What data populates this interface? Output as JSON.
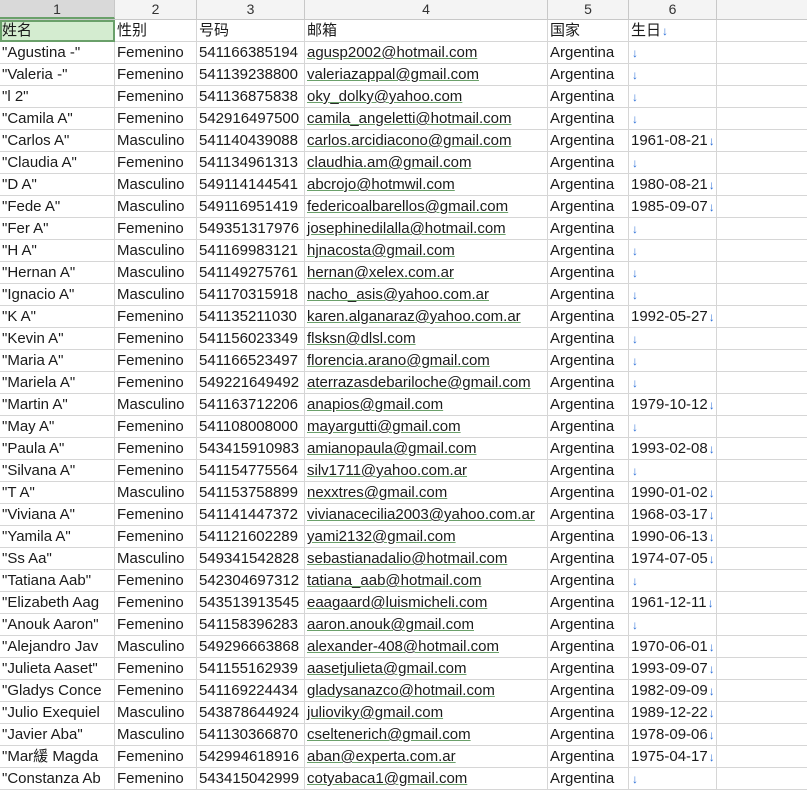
{
  "columns": [
    "1",
    "2",
    "3",
    "4",
    "5",
    "6"
  ],
  "headers": [
    "姓名",
    "性别",
    "号码",
    "邮箱",
    "国家",
    "生日"
  ],
  "arrow_glyph": "↓",
  "rows": [
    [
      "\"Agustina -\"",
      "Femenino",
      "541166385194",
      "agusp2002@hotmail.com",
      "Argentina",
      ""
    ],
    [
      "\"Valeria -\"",
      "Femenino",
      "541139238800",
      "valeriazappal@gmail.com",
      "Argentina",
      ""
    ],
    [
      "\"l 2\"",
      "Femenino",
      "541136875838",
      "oky_dolky@yahoo.com",
      "Argentina",
      ""
    ],
    [
      "\"Camila A\"",
      "Femenino",
      "542916497500",
      "camila_angeletti@hotmail.com",
      "Argentina",
      ""
    ],
    [
      "\"Carlos A\"",
      "Masculino",
      "541140439088",
      "carlos.arcidiacono@gmail.com",
      "Argentina",
      "1961-08-21"
    ],
    [
      "\"Claudia A\"",
      "Femenino",
      "541134961313",
      "claudhia.am@gmail.com",
      "Argentina",
      ""
    ],
    [
      "\"D A\"",
      "Masculino",
      "549114144541",
      "abcrojo@hotmwil.com",
      "Argentina",
      "1980-08-21"
    ],
    [
      "\"Fede A\"",
      "Masculino",
      "549116951419",
      "federicoalbarellos@gmail.com",
      "Argentina",
      "1985-09-07"
    ],
    [
      "\"Fer A\"",
      "Femenino",
      "549351317976",
      "josephinedilalla@hotmail.com",
      "Argentina",
      ""
    ],
    [
      "\"H A\"",
      "Masculino",
      "541169983121",
      "hjnacosta@gmail.com",
      "Argentina",
      ""
    ],
    [
      "\"Hernan A\"",
      "Masculino",
      "541149275761",
      "hernan@xelex.com.ar",
      "Argentina",
      ""
    ],
    [
      "\"Ignacio A\"",
      "Masculino",
      "541170315918",
      "nacho_asis@yahoo.com.ar",
      "Argentina",
      ""
    ],
    [
      "\"K A\"",
      "Femenino",
      "541135211030",
      "karen.alganaraz@yahoo.com.ar",
      "Argentina",
      "1992-05-27"
    ],
    [
      "\"Kevin A\"",
      "Femenino",
      "541156023349",
      "flsksn@dlsl.com",
      "Argentina",
      ""
    ],
    [
      "\"Maria A\"",
      "Femenino",
      "541166523497",
      "florencia.arano@gmail.com",
      "Argentina",
      ""
    ],
    [
      "\"Mariela A\"",
      "Femenino",
      "549221649492",
      "aterrazasdebariloche@gmail.com",
      "Argentina",
      ""
    ],
    [
      "\"Martin A\"",
      "Masculino",
      "541163712206",
      "anapios@gmail.com",
      "Argentina",
      "1979-10-12"
    ],
    [
      "\"May A\"",
      "Femenino",
      "541108008000",
      "mayargutti@gmail.com",
      "Argentina",
      ""
    ],
    [
      "\"Paula A\"",
      "Femenino",
      "543415910983",
      "amianopaula@gmail.com",
      "Argentina",
      "1993-02-08"
    ],
    [
      "\"Silvana A\"",
      "Femenino",
      "541154775564",
      "silv1711@yahoo.com.ar",
      "Argentina",
      ""
    ],
    [
      "\"T A\"",
      "Masculino",
      "541153758899",
      "nexxtres@gmail.com",
      "Argentina",
      "1990-01-02"
    ],
    [
      "\"Viviana A\"",
      "Femenino",
      "541141447372",
      "vivianacecilia2003@yahoo.com.ar",
      "Argentina",
      "1968-03-17"
    ],
    [
      "\"Yamila A\"",
      "Femenino",
      "541121602289",
      "yami2132@gmail.com",
      "Argentina",
      "1990-06-13"
    ],
    [
      "\"Ss Aa\"",
      "Masculino",
      "549341542828",
      "sebastianadalio@hotmail.com",
      "Argentina",
      "1974-07-05"
    ],
    [
      "\"Tatiana Aab\"",
      "Femenino",
      "542304697312",
      "tatiana_aab@hotmail.com",
      "Argentina",
      ""
    ],
    [
      "\"Elizabeth Aag",
      "Femenino",
      "543513913545",
      "eaagaard@luismicheli.com",
      "Argentina",
      "1961-12-11"
    ],
    [
      "\"Anouk Aaron\"",
      "Femenino",
      "541158396283",
      "aaron.anouk@gmail.com",
      "Argentina",
      ""
    ],
    [
      "\"Alejandro Jav",
      "Masculino",
      "549296663868",
      "alexander-408@hotmail.com",
      "Argentina",
      "1970-06-01"
    ],
    [
      "\"Julieta Aaset\"",
      "Femenino",
      "541155162939",
      "aasetjulieta@gmail.com",
      "Argentina",
      "1993-09-07"
    ],
    [
      "\"Gladys Conce",
      "Femenino",
      "541169224434",
      "gladysanazco@hotmail.com",
      "Argentina",
      "1982-09-09"
    ],
    [
      "\"Julio Exequiel",
      "Masculino",
      "543878644924",
      "julioviky@gmail.com",
      "Argentina",
      "1989-12-22"
    ],
    [
      "\"Javier Aba\"",
      "Masculino",
      "541130366870",
      "cseltenerich@gmail.com",
      "Argentina",
      "1978-09-06"
    ],
    [
      "\"Mar緩 Magda",
      "Femenino",
      "542994618916",
      "aban@experta.com.ar",
      "Argentina",
      "1975-04-17"
    ],
    [
      "\"Constanza Ab",
      "Femenino",
      "543415042999",
      "cotyabaca1@gmail.com",
      "Argentina",
      ""
    ]
  ]
}
